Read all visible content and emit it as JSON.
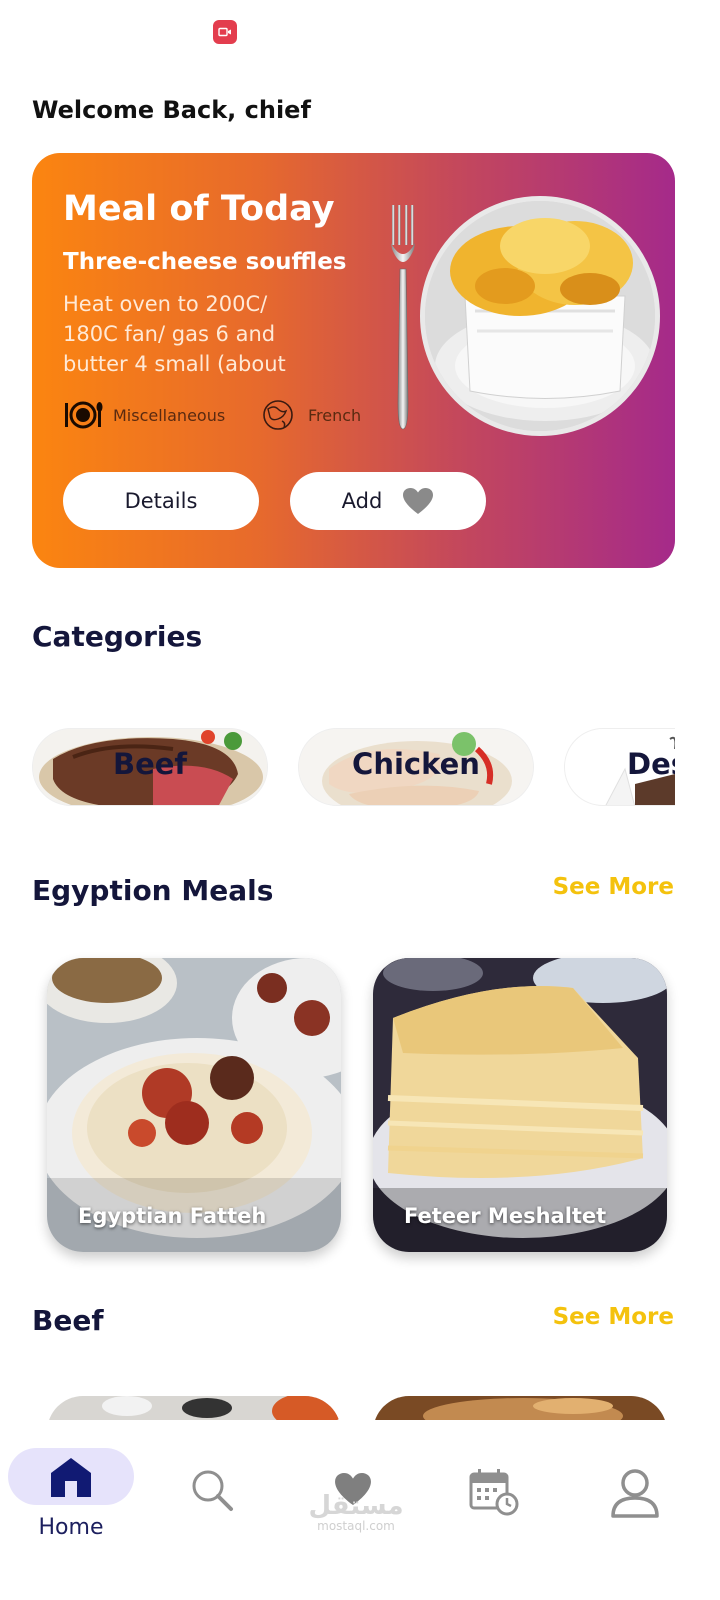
{
  "header": {
    "welcome": "Welcome Back, chief"
  },
  "meal_of_today": {
    "title": "Meal of Today",
    "name": "Three-cheese souffles",
    "description_lines": [
      "Heat oven to 200C/",
      "180C fan/ gas 6 and",
      "butter 4 small (about"
    ],
    "category": "Miscellaneous",
    "area": "French",
    "details_label": "Details",
    "add_label": "Add"
  },
  "categories": {
    "title": "Categories",
    "items": [
      "Beef",
      "Chicken",
      "Des"
    ]
  },
  "egyptian": {
    "title": "Egyption Meals",
    "see_more": "See More",
    "meals": [
      "Egyptian Fatteh",
      "Feteer Meshaltet"
    ]
  },
  "beef": {
    "title": "Beef",
    "see_more": "See More"
  },
  "nav": {
    "home_label": "Home",
    "items": [
      "home-icon",
      "search-icon",
      "heart-icon",
      "calendar-icon",
      "profile-icon"
    ]
  },
  "watermark": {
    "arabic": "مستقل",
    "latin": "mostaql.com"
  },
  "colors": {
    "accent": "#f4c20d",
    "navy": "#14163b",
    "nav_pill": "#e6e3fb"
  }
}
